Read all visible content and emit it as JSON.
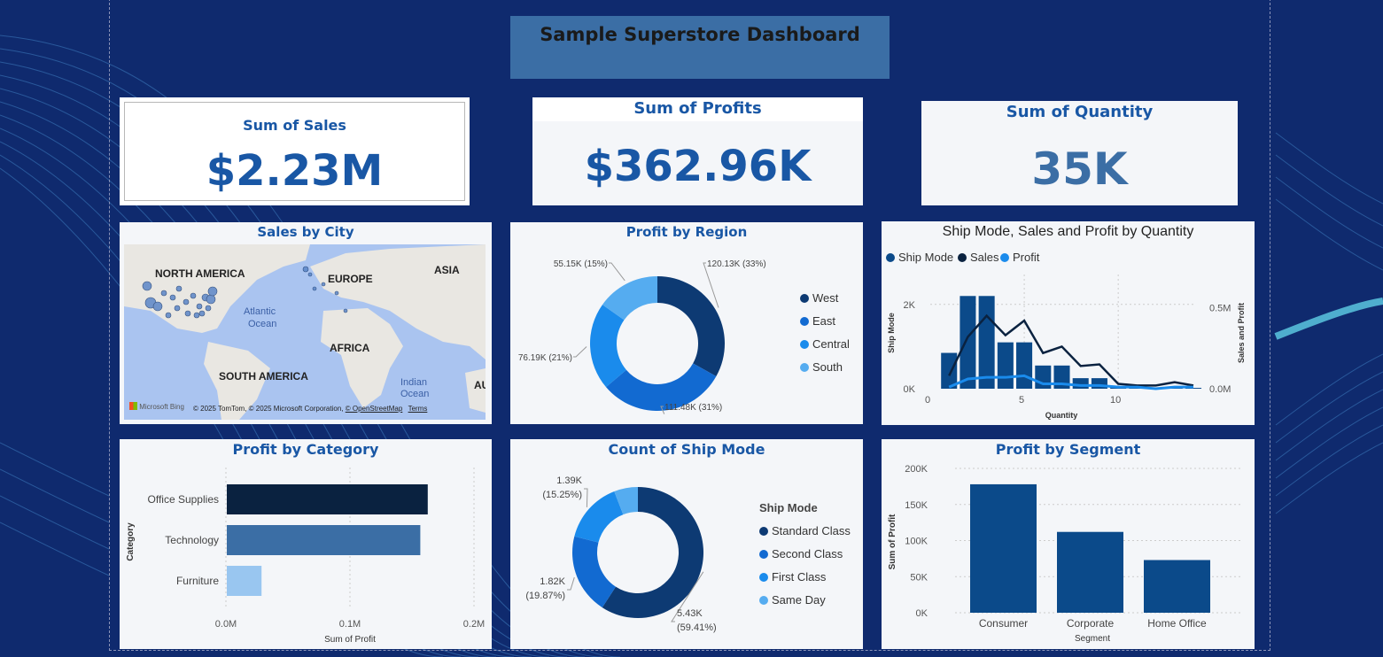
{
  "title": "Sample Superstore Dashboard",
  "kpis": {
    "sales": {
      "label": "Sum of Sales",
      "value": "$2.23M"
    },
    "profits": {
      "label": "Sum of Profits",
      "value": "$362.96K"
    },
    "quantity": {
      "label": "Sum of Quantity",
      "value": "35K"
    }
  },
  "map": {
    "title": "Sales by City",
    "labels": {
      "north_america": "NORTH AMERICA",
      "europe": "EUROPE",
      "asia": "ASIA",
      "atlantic": "Atlantic",
      "ocean1": "Ocean",
      "africa": "AFRICA",
      "south_america": "SOUTH AMERICA",
      "indian": "Indian",
      "ocean2": "Ocean",
      "au": "AU"
    },
    "attribution": "© 2025 TomTom, © 2025 Microsoft Corporation,",
    "osm": "© OpenStreetMap",
    "terms": "Terms",
    "brand": "Microsoft Bing"
  },
  "colors": {
    "dark_navy": "#0d3a73",
    "medium_blue": "#126ad1",
    "bright_blue": "#1a8bec",
    "light_blue": "#55acf0",
    "kpi_blue": "#1957a5",
    "cat_dark": "#0a2240",
    "cat_mid": "#3b6ea5",
    "cat_light": "#99c6f0",
    "segment": "#0b4a8a"
  },
  "chart_data": [
    {
      "id": "profit_by_region",
      "type": "pie",
      "title": "Profit by Region",
      "categories": [
        "West",
        "East",
        "Central",
        "South"
      ],
      "values": [
        120.13,
        111.48,
        76.19,
        55.15
      ],
      "value_labels": [
        "120.13K (33%)",
        "111.48K (31%)",
        "76.19K (21%)",
        "55.15K (15%)"
      ],
      "colors": [
        "#0d3a73",
        "#126ad1",
        "#1a8bec",
        "#55acf0"
      ]
    },
    {
      "id": "ship_mode_sales_profit",
      "type": "line",
      "title": "Ship Mode, Sales and Profit by Quantity",
      "legend": [
        "Ship Mode",
        "Sales",
        "Profit"
      ],
      "xlabel": "Quantity",
      "ylabel": "Ship Mode",
      "y2label": "Sales and Profit",
      "x_ticks": [
        "0",
        "5",
        "10"
      ],
      "y_ticks": [
        "0K",
        "2K"
      ],
      "y2_ticks": [
        "0.0M",
        "0.5M"
      ],
      "xlim": [
        0,
        14
      ],
      "ylim": [
        0,
        2.5
      ],
      "y2lim": [
        0,
        0.65
      ],
      "x": [
        1,
        2,
        3,
        4,
        5,
        6,
        7,
        8,
        9,
        10,
        11,
        12,
        13,
        14
      ],
      "series": [
        {
          "name": "Ship Mode",
          "type": "bar",
          "values": [
            0.85,
            2.2,
            2.2,
            1.1,
            1.1,
            0.55,
            0.55,
            0.25,
            0.25,
            0.04,
            0.03,
            0.03,
            0.03,
            0.02
          ]
        },
        {
          "name": "Sales",
          "values": [
            0.08,
            0.32,
            0.45,
            0.33,
            0.42,
            0.22,
            0.26,
            0.14,
            0.15,
            0.03,
            0.02,
            0.02,
            0.04,
            0.02
          ]
        },
        {
          "name": "Profit",
          "values": [
            0.01,
            0.06,
            0.07,
            0.07,
            0.08,
            0.03,
            0.03,
            0.02,
            0.02,
            0.01,
            0.01,
            0.0,
            0.01,
            0.01
          ]
        }
      ],
      "colors": [
        "#0b4a8a",
        "#0a2240",
        "#1a8bec"
      ]
    },
    {
      "id": "profit_by_category",
      "type": "bar",
      "orientation": "horizontal",
      "title": "Profit by Category",
      "categories": [
        "Office Supplies",
        "Technology",
        "Furniture"
      ],
      "values": [
        0.162,
        0.156,
        0.028
      ],
      "xlabel": "Sum of Profit",
      "ylabel": "Category",
      "x_ticks": [
        "0.0M",
        "0.1M",
        "0.2M"
      ],
      "xlim": [
        0,
        0.2
      ],
      "colors": [
        "#0a2240",
        "#3b6ea5",
        "#99c6f0"
      ]
    },
    {
      "id": "count_of_ship_mode",
      "type": "pie",
      "title": "Count of Ship Mode",
      "legend_title": "Ship Mode",
      "categories": [
        "Standard Class",
        "Second Class",
        "First Class",
        "Same Day"
      ],
      "values": [
        5.43,
        1.82,
        1.39,
        0.54
      ],
      "value_labels": [
        [
          "5.43K",
          "(59.41%)"
        ],
        [
          "1.82K",
          "(19.87%)"
        ],
        [
          "1.39K",
          "(15.25%)"
        ]
      ],
      "colors": [
        "#0d3a73",
        "#126ad1",
        "#1a8bec",
        "#55acf0"
      ]
    },
    {
      "id": "profit_by_segment",
      "type": "bar",
      "title": "Profit by Segment",
      "categories": [
        "Consumer",
        "Corporate",
        "Home Office"
      ],
      "values": [
        178,
        112,
        73
      ],
      "xlabel": "Segment",
      "ylabel": "Sum of Profit",
      "y_ticks": [
        "0K",
        "50K",
        "100K",
        "150K",
        "200K"
      ],
      "ylim": [
        0,
        200
      ],
      "colors": [
        "#0b4a8a"
      ]
    }
  ]
}
